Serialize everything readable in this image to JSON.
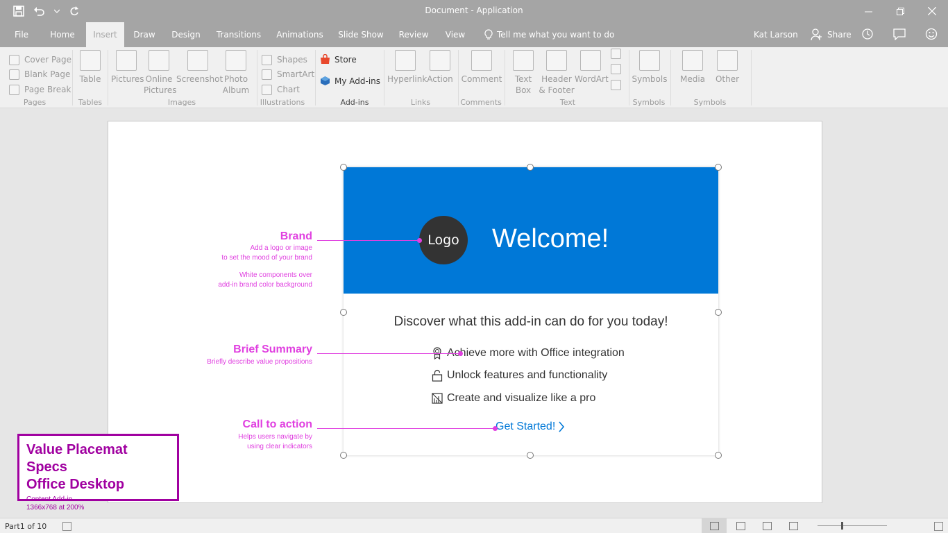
{
  "window": {
    "title": "Document - Application"
  },
  "tabs": [
    "File",
    "Home",
    "Insert",
    "Draw",
    "Design",
    "Transitions",
    "Animations",
    "Slide Show",
    "Review",
    "View"
  ],
  "active_tab": "Insert",
  "tell_me": "Tell me what you want to do",
  "user": "Kat Larson",
  "share_label": "Share",
  "ribbon": {
    "pages": {
      "items": [
        "Cover Page",
        "Blank Page",
        "Page Break"
      ],
      "label": "Pages"
    },
    "tables": {
      "button": "Table",
      "label": "Tables"
    },
    "images": {
      "buttons": [
        "Pictures",
        "Online Pictures",
        "Screenshot",
        "Photo Album"
      ],
      "label": "Images"
    },
    "illustrations": {
      "items": [
        "Shapes",
        "SmartArt",
        "Chart"
      ],
      "label": "Illustrations"
    },
    "addins": {
      "store": "Store",
      "my_addins": "My Add-ins",
      "label": "Add-ins"
    },
    "links": {
      "buttons": [
        "Hyperlink",
        "Action"
      ],
      "label": "Links"
    },
    "comments": {
      "button": "Comment",
      "label": "Comments"
    },
    "text": {
      "buttons": [
        "Text Box",
        "Header & Footer",
        "WordArt"
      ],
      "label": "Text"
    },
    "symbols": {
      "button": "Symbols",
      "label": "Symbols"
    },
    "media": {
      "buttons": [
        "Media",
        "Other"
      ],
      "label": "Symbols"
    }
  },
  "card": {
    "logo": "Logo",
    "welcome": "Welcome!",
    "discover": "Discover what this add-in can do for you today!",
    "features": [
      {
        "icon": "ribbon-award-icon",
        "text": "Achieve more with Office integration"
      },
      {
        "icon": "unlock-icon",
        "text": "Unlock features and functionality"
      },
      {
        "icon": "design-ideas-icon",
        "text": "Create and visualize like a pro"
      }
    ],
    "cta": "Get Started!",
    "header_color": "#0078d7"
  },
  "annotations": {
    "brand": {
      "title": "Brand",
      "lines": [
        "Add a logo or image",
        "to set the mood of your brand",
        "",
        "White components over",
        "add-in brand color background"
      ]
    },
    "summary": {
      "title": "Brief Summary",
      "lines": [
        "Briefly describe value propositions"
      ]
    },
    "cta": {
      "title": "Call to action",
      "lines": [
        "Helps users navigate by",
        "using clear indicators"
      ]
    },
    "color": "#e040e0"
  },
  "spec": {
    "line1": "Value Placemat Specs",
    "line2": "Office Desktop",
    "line3": "Content Add-in",
    "line4": "1366x768 at 200%",
    "color": "#a000a0"
  },
  "status": {
    "part": "Part1 of 10"
  }
}
